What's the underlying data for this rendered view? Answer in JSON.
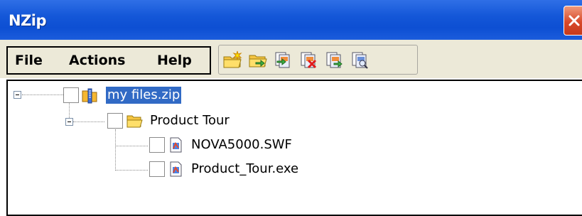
{
  "window": {
    "title": "NZip"
  },
  "menu": {
    "items": [
      {
        "label": "File"
      },
      {
        "label": "Actions"
      },
      {
        "label": "Help"
      }
    ]
  },
  "toolbar": {
    "buttons": [
      {
        "icon": "new-archive-icon"
      },
      {
        "icon": "open-archive-icon"
      },
      {
        "icon": "add-files-icon"
      },
      {
        "icon": "delete-files-icon"
      },
      {
        "icon": "extract-files-icon"
      },
      {
        "icon": "view-file-icon"
      }
    ]
  },
  "tree": {
    "nodes": [
      {
        "label": "my files.zip",
        "type": "zip-archive",
        "level": 0,
        "expanded": true,
        "selected": true
      },
      {
        "label": "Product Tour",
        "type": "folder",
        "level": 1,
        "expanded": true,
        "selected": false
      },
      {
        "label": "NOVA5000.SWF",
        "type": "file",
        "level": 2,
        "selected": false
      },
      {
        "label": "Product_Tour.exe",
        "type": "file",
        "level": 2,
        "selected": false
      }
    ]
  },
  "colors": {
    "titlebar": "#0d4fd3",
    "close_button": "#d8492a",
    "selection": "#316ac5",
    "chrome": "#ece9d8"
  }
}
